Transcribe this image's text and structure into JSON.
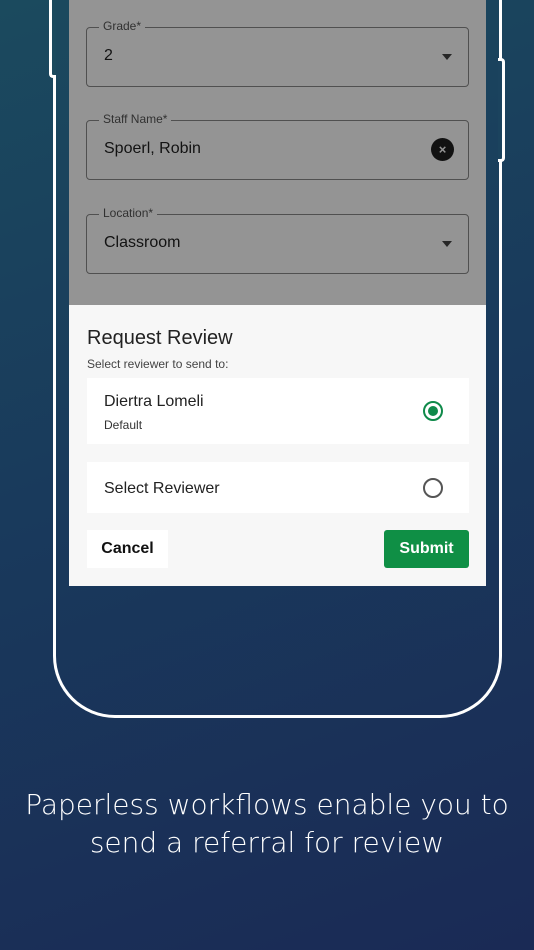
{
  "form": {
    "grade": {
      "label": "Grade*",
      "value": "2"
    },
    "staff": {
      "label": "Staff Name*",
      "value": "Spoerl, Robin",
      "clear_icon": "×"
    },
    "location": {
      "label": "Location*",
      "value": "Classroom"
    }
  },
  "dialog": {
    "title": "Request Review",
    "subtitle": "Select reviewer to send to:",
    "options": [
      {
        "name": "Diertra Lomeli",
        "sub": "Default",
        "selected": true
      },
      {
        "name": "Select Reviewer",
        "selected": false
      }
    ],
    "cancel_label": "Cancel",
    "submit_label": "Submit"
  },
  "caption": {
    "line1": "Paperless workflows enable you to",
    "line2": "send a referral for review"
  },
  "colors": {
    "accent": "#0f8f45",
    "background_start": "#1b4a5e",
    "background_end": "#1a2a55"
  }
}
